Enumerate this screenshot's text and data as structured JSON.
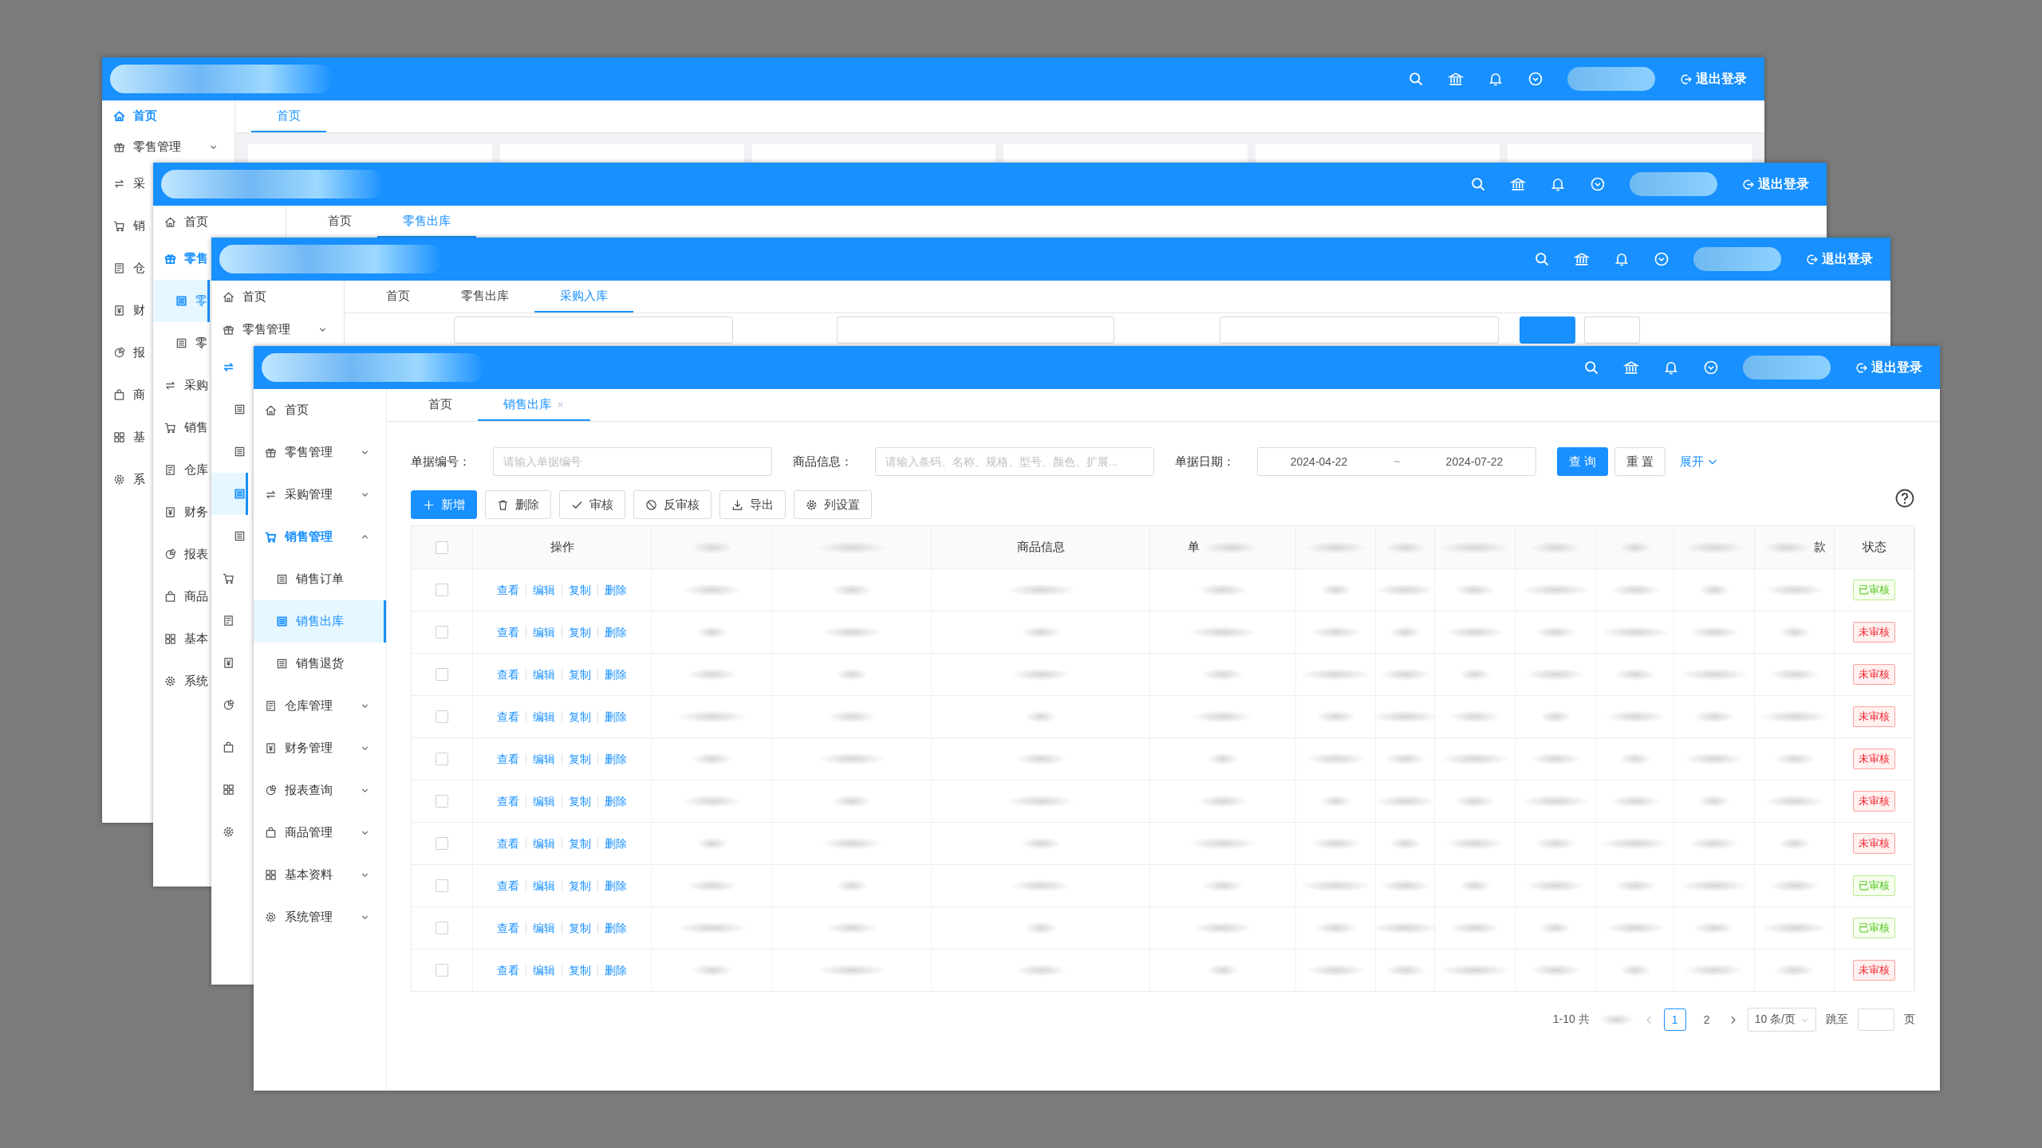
{
  "windows": [
    {
      "kind": "dashboard",
      "header": {
        "logout": "退出登录"
      },
      "sidebar": [
        {
          "label": "首页",
          "kind": "home",
          "selected": true
        },
        {
          "label": "零售管理",
          "kind": "retail",
          "selected": false,
          "expanded": false
        },
        {
          "label": "采",
          "kind": "purchase",
          "selected": false
        },
        {
          "label": "销",
          "kind": "sales",
          "selected": false
        },
        {
          "label": "仓",
          "kind": "warehouse",
          "selected": false
        },
        {
          "label": "财",
          "kind": "finance",
          "selected": false
        },
        {
          "label": "报",
          "kind": "report",
          "selected": false
        },
        {
          "label": "商",
          "kind": "goods",
          "selected": false
        },
        {
          "label": "基",
          "kind": "basic",
          "selected": false
        },
        {
          "label": "系",
          "kind": "system",
          "selected": false
        }
      ],
      "tabs": [
        {
          "label": "首页",
          "selected": true,
          "closable": false
        }
      ]
    },
    {
      "kind": "blank",
      "header": {
        "logout": "退出登录"
      },
      "sidebar": [
        {
          "label": "首页",
          "kind": "home",
          "selected": false
        },
        {
          "label": "零售",
          "kind": "retail",
          "selected": true
        },
        {
          "label": "零",
          "kind": "sub",
          "selected": true
        },
        {
          "label": "零",
          "kind": "sub",
          "selected": false
        },
        {
          "label": "采购",
          "kind": "purchase",
          "selected": false
        },
        {
          "label": "销售",
          "kind": "sales",
          "selected": false
        },
        {
          "label": "仓库",
          "kind": "warehouse",
          "selected": false
        },
        {
          "label": "财务",
          "kind": "finance",
          "selected": false
        },
        {
          "label": "报表",
          "kind": "report",
          "selected": false
        },
        {
          "label": "商品",
          "kind": "goods",
          "selected": false
        },
        {
          "label": "基本",
          "kind": "basic",
          "selected": false
        },
        {
          "label": "系统",
          "kind": "system",
          "selected": false
        }
      ],
      "tabs": [
        {
          "label": "首页",
          "selected": false,
          "closable": false
        },
        {
          "label": "零售出库",
          "selected": true,
          "closable": false
        }
      ]
    },
    {
      "kind": "search",
      "header": {
        "logout": "退出登录"
      },
      "sidebar": [
        {
          "label": "首页",
          "kind": "home",
          "selected": false
        },
        {
          "label": "零售管理",
          "kind": "retail",
          "selected": false,
          "expanded": false
        },
        {
          "kind": "purchase",
          "selected": true
        },
        {
          "kind": "sub",
          "selected": false
        },
        {
          "kind": "sub",
          "selected": false
        },
        {
          "kind": "sub",
          "selected": true
        },
        {
          "kind": "sub",
          "selected": false
        },
        {
          "kind": "sales",
          "selected": false
        },
        {
          "kind": "warehouse",
          "selected": false
        },
        {
          "kind": "finance",
          "selected": false
        },
        {
          "kind": "report",
          "selected": false
        },
        {
          "kind": "goods",
          "selected": false
        },
        {
          "kind": "basic",
          "selected": false
        },
        {
          "kind": "system",
          "selected": false
        }
      ],
      "tabs": [
        {
          "label": "首页",
          "selected": false,
          "closable": false
        },
        {
          "label": "零售出库",
          "selected": false,
          "closable": false
        },
        {
          "label": "采购入库",
          "selected": true,
          "closable": false
        }
      ]
    },
    {
      "kind": "list",
      "header": {
        "logout": "退出登录"
      },
      "sidebar": [
        {
          "label": "首页",
          "kind": "home",
          "selected": false
        },
        {
          "label": "零售管理",
          "kind": "retail",
          "selected": false,
          "expanded": false
        },
        {
          "label": "采购管理",
          "kind": "purchase",
          "selected": false,
          "expanded": false
        },
        {
          "label": "销售管理",
          "kind": "sales",
          "selected": true,
          "expanded": true
        },
        {
          "label": "销售订单",
          "kind": "sub",
          "selected": false
        },
        {
          "label": "销售出库",
          "kind": "sub",
          "selected": true
        },
        {
          "label": "销售退货",
          "kind": "sub",
          "selected": false
        },
        {
          "label": "仓库管理",
          "kind": "warehouse",
          "selected": false,
          "expanded": false
        },
        {
          "label": "财务管理",
          "kind": "finance",
          "selected": false,
          "expanded": false
        },
        {
          "label": "报表查询",
          "kind": "report",
          "selected": false,
          "expanded": false
        },
        {
          "label": "商品管理",
          "kind": "goods",
          "selected": false,
          "expanded": false
        },
        {
          "label": "基本资料",
          "kind": "basic",
          "selected": false,
          "expanded": false
        },
        {
          "label": "系统管理",
          "kind": "system",
          "selected": false,
          "expanded": false
        }
      ],
      "tabs": [
        {
          "label": "首页",
          "selected": false,
          "closable": false
        },
        {
          "label": "销售出库",
          "selected": true,
          "closable": true
        }
      ],
      "filters": [
        {
          "label": "单据编号：",
          "kind": "text",
          "placeholder": "请输入单据编号"
        },
        {
          "label": "商品信息：",
          "kind": "text",
          "placeholder": "请输入条码、名称、规格、型号、颜色、扩展..."
        },
        {
          "label": "单据日期：",
          "kind": "daterange",
          "start": "2024-04-22",
          "separator": "~",
          "end": "2024-07-22"
        }
      ],
      "filter_buttons": [
        {
          "label": "查 询",
          "primary": true
        },
        {
          "label": "重 置",
          "primary": false
        }
      ],
      "expand": {
        "label": "展开"
      },
      "toolbar": [
        {
          "label": "新增",
          "kind": "add",
          "primary": true
        },
        {
          "label": "删除",
          "kind": "delete",
          "primary": false
        },
        {
          "label": "审核",
          "kind": "approve",
          "primary": false
        },
        {
          "label": "反审核",
          "kind": "unapprove",
          "primary": false
        },
        {
          "label": "导出",
          "kind": "export",
          "primary": false
        },
        {
          "label": "列设置",
          "kind": "columns",
          "primary": false
        }
      ],
      "table": {
        "select_all": {
          "checked": false
        },
        "columns": [
          {
            "kind": "checkbox"
          },
          {
            "label": "操作",
            "kind": "actions"
          },
          {
            "kind": "blurred"
          },
          {
            "kind": "blurred"
          },
          {
            "label": "商品信息",
            "kind": "blurred"
          },
          {
            "label": "单",
            "kind": "blurred-lead"
          },
          {
            "kind": "blurred"
          },
          {
            "kind": "blurred"
          },
          {
            "kind": "blurred"
          },
          {
            "kind": "blurred"
          },
          {
            "kind": "blurred"
          },
          {
            "kind": "blurred"
          },
          {
            "label": "款",
            "kind": "blurred-tail"
          },
          {
            "label": "状态",
            "kind": "status"
          }
        ],
        "rows": [
          {
            "checked": false,
            "actions": [
              "查看",
              "编辑",
              "复制",
              "删除"
            ],
            "status": {
              "text": "已审核",
              "kind": "approved"
            }
          },
          {
            "checked": false,
            "actions": [
              "查看",
              "编辑",
              "复制",
              "删除"
            ],
            "status": {
              "text": "未审核",
              "kind": "unapproved"
            }
          },
          {
            "checked": false,
            "actions": [
              "查看",
              "编辑",
              "复制",
              "删除"
            ],
            "status": {
              "text": "未审核",
              "kind": "unapproved"
            }
          },
          {
            "checked": false,
            "actions": [
              "查看",
              "编辑",
              "复制",
              "删除"
            ],
            "status": {
              "text": "未审核",
              "kind": "unapproved"
            }
          },
          {
            "checked": false,
            "actions": [
              "查看",
              "编辑",
              "复制",
              "删除"
            ],
            "status": {
              "text": "未审核",
              "kind": "unapproved"
            }
          },
          {
            "checked": false,
            "actions": [
              "查看",
              "编辑",
              "复制",
              "删除"
            ],
            "status": {
              "text": "未审核",
              "kind": "unapproved"
            }
          },
          {
            "checked": false,
            "actions": [
              "查看",
              "编辑",
              "复制",
              "删除"
            ],
            "status": {
              "text": "未审核",
              "kind": "unapproved"
            }
          },
          {
            "checked": false,
            "actions": [
              "查看",
              "编辑",
              "复制",
              "删除"
            ],
            "status": {
              "text": "已审核",
              "kind": "approved"
            }
          },
          {
            "checked": false,
            "actions": [
              "查看",
              "编辑",
              "复制",
              "删除"
            ],
            "status": {
              "text": "已审核",
              "kind": "approved"
            }
          },
          {
            "checked": false,
            "actions": [
              "查看",
              "编辑",
              "复制",
              "删除"
            ],
            "status": {
              "text": "未审核",
              "kind": "unapproved"
            }
          }
        ]
      },
      "pagination": {
        "summary": "1-10 共",
        "pages": [
          {
            "label": "1",
            "selected": true
          },
          {
            "label": "2",
            "selected": false
          }
        ],
        "page_size": "10 条/页",
        "jump_label": "跳至",
        "jump_suffix": "页"
      }
    }
  ]
}
